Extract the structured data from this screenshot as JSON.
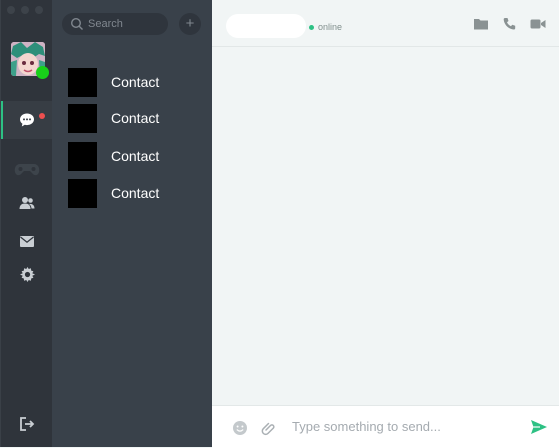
{
  "user": {
    "presence_color": "#18d11a"
  },
  "nav": {
    "items": [
      {
        "id": "chats",
        "icon": "chat-bubble-icon",
        "active": true,
        "badge": true
      },
      {
        "id": "game",
        "icon": "gamepad-icon"
      },
      {
        "id": "contacts",
        "icon": "contacts-icon"
      },
      {
        "id": "mail",
        "icon": "mail-icon"
      },
      {
        "id": "settings",
        "icon": "gear-icon"
      },
      {
        "id": "logout",
        "icon": "logout-icon"
      }
    ]
  },
  "search": {
    "placeholder": "Search"
  },
  "add_button": {
    "label": "+"
  },
  "contacts": [
    {
      "name": "Contact"
    },
    {
      "name": "Contact"
    },
    {
      "name": "Contact"
    },
    {
      "name": "Contact"
    }
  ],
  "conversation": {
    "status": "online",
    "actions": [
      "folder-icon",
      "phone-icon",
      "video-camera-icon"
    ]
  },
  "composer": {
    "placeholder": "Type something to send...",
    "icons": [
      "emoji-icon",
      "attachment-icon",
      "send-icon"
    ]
  },
  "colors": {
    "accent": "#2dc184",
    "badge": "#ee4f4f",
    "rail_bg": "#2f343b",
    "list_bg": "#39414a",
    "main_bg": "#f1f5f5"
  }
}
